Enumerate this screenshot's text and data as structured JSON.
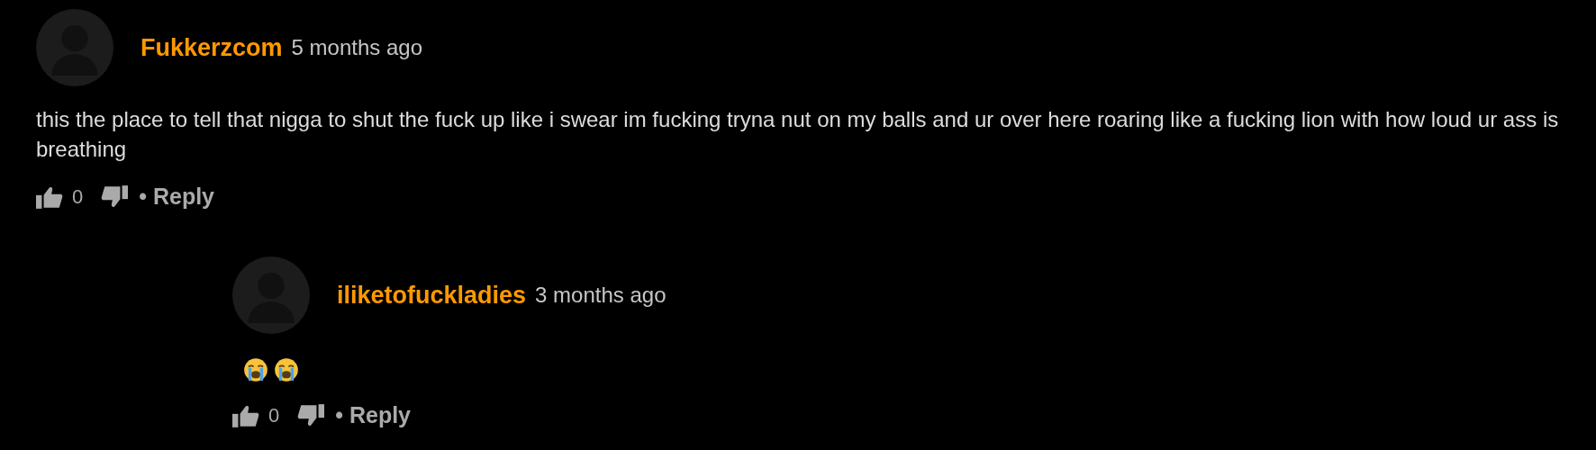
{
  "comments": [
    {
      "username": "Fukkerzcom",
      "time": "5 months ago",
      "text": " this the place to tell that nigga to shut the fuck up like i swear im fucking tryna nut on my balls and ur over here roaring like a fucking lion with how loud ur ass is breathing",
      "likes": "0",
      "reply": "• Reply",
      "replies": [
        {
          "username": "iliketofuckladies",
          "time": "3 months ago",
          "emojis": [
            {
              "kind": "crying-face"
            },
            {
              "kind": "crying-face"
            }
          ],
          "likes": "0",
          "reply": "• Reply"
        }
      ]
    }
  ]
}
